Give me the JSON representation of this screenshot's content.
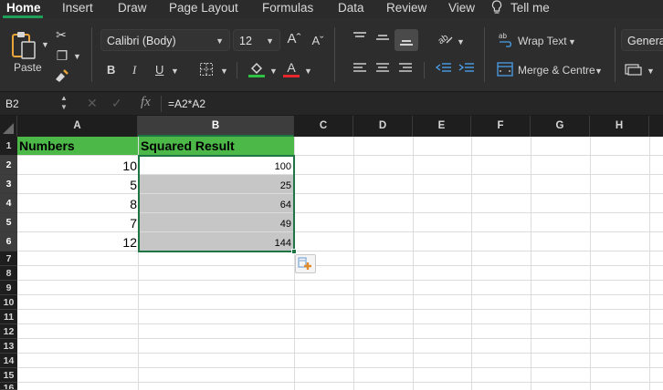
{
  "ribbon_tabs": [
    "Home",
    "Insert",
    "Draw",
    "Page Layout",
    "Formulas",
    "Data",
    "Review",
    "View",
    "Tell me"
  ],
  "clipboard": {
    "paste_label": "Paste"
  },
  "font": {
    "name": "Calibri (Body)",
    "size": "12"
  },
  "format_buttons": {
    "bold": "B",
    "italic": "I",
    "underline": "U"
  },
  "alignment": {
    "wrap_text": "Wrap Text",
    "merge_centre": "Merge & Centre"
  },
  "number_format": "Genera",
  "formula_bar": {
    "name_box": "B2",
    "fx": "fx",
    "formula": "=A2*A2"
  },
  "columns": [
    "A",
    "B",
    "C",
    "D",
    "E",
    "F",
    "G",
    "H"
  ],
  "rows": [
    "1",
    "2",
    "3",
    "4",
    "5",
    "6",
    "7",
    "8",
    "9",
    "10",
    "11",
    "12",
    "13",
    "14",
    "15",
    "16"
  ],
  "sheet": {
    "header_a": "Numbers",
    "header_b": "Squared Result",
    "numbers": [
      "10",
      "5",
      "8",
      "7",
      "12"
    ],
    "squared": [
      "100",
      "25",
      "64",
      "49",
      "144"
    ]
  },
  "colors": {
    "header_fill": "#4cb848",
    "selection_fill": "#c6c6c6",
    "selection_border": "#1d7544",
    "ribbon_bg": "#2d2d2d",
    "font_color_bar": "#e8262e",
    "highlight_bar": "#2fc145"
  }
}
